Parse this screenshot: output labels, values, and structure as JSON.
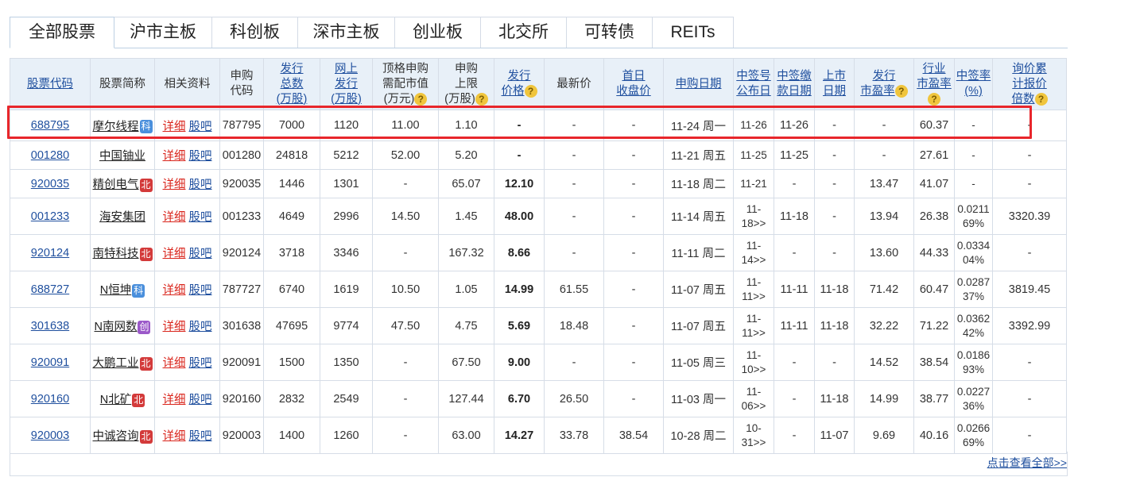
{
  "tabs": [
    {
      "label": "全部股票",
      "active": true,
      "width": 130
    },
    {
      "label": "沪市主板",
      "width": 122
    },
    {
      "label": "科创板",
      "width": 107
    },
    {
      "label": "深市主板",
      "width": 121
    },
    {
      "label": "创业板",
      "width": 107
    },
    {
      "label": "北交所",
      "width": 107
    },
    {
      "label": "可转债",
      "width": 107
    },
    {
      "label": "REITs",
      "width": 101
    }
  ],
  "headers": [
    {
      "lines": [
        "股票代码"
      ],
      "link": true
    },
    {
      "lines": [
        "股票简称"
      ]
    },
    {
      "lines": [
        "相关资料"
      ]
    },
    {
      "lines": [
        "申购",
        "代码"
      ]
    },
    {
      "lines": [
        "发行",
        "总数",
        "(万股)"
      ],
      "link": true
    },
    {
      "lines": [
        "网上",
        "发行",
        "(万股)"
      ],
      "link": true
    },
    {
      "lines": [
        "顶格申购",
        "需配市值",
        "(万元)"
      ],
      "q": true
    },
    {
      "lines": [
        "申购",
        "上限",
        "(万股)"
      ],
      "q": true
    },
    {
      "lines": [
        "发行",
        "价格"
      ],
      "link": true,
      "q": true
    },
    {
      "lines": [
        "最新价"
      ]
    },
    {
      "lines": [
        "首日",
        "收盘价"
      ],
      "link": true
    },
    {
      "lines": [
        "申购日期"
      ],
      "link": true
    },
    {
      "lines": [
        "中签号",
        "公布日"
      ],
      "link": true
    },
    {
      "lines": [
        "中签缴",
        "款日期"
      ],
      "link": true
    },
    {
      "lines": [
        "上市",
        "日期"
      ],
      "link": true
    },
    {
      "lines": [
        "发行",
        "市盈率"
      ],
      "link": true,
      "q": true
    },
    {
      "lines": [
        "行业",
        "市盈率"
      ],
      "link": true,
      "q": true
    },
    {
      "lines": [
        "中签率",
        "(%)"
      ],
      "link": true
    },
    {
      "lines": [
        "询价累",
        "计报价",
        "倍数"
      ],
      "link": true,
      "q": true
    }
  ],
  "links": {
    "detail": "详细",
    "bar": "股吧"
  },
  "rows": [
    {
      "code": "688795",
      "name": "摩尔线程",
      "badge": "科",
      "btype": "ke",
      "sub_code": "787795",
      "total": "7000",
      "online": "1120",
      "mktcap": "11.00",
      "limit": "1.10",
      "price": "-",
      "latest": "-",
      "first_close": "-",
      "sub_date": "11-24 周一",
      "lot_date": [
        "11-26"
      ],
      "pay_date": "11-26",
      "list_date": "-",
      "issue_pe": "-",
      "ind_pe": "60.37",
      "rate": [
        "-"
      ],
      "mult": "-",
      "cls": "hl"
    },
    {
      "code": "001280",
      "name": "中国铀业",
      "badge": "",
      "btype": "",
      "sub_code": "001280",
      "total": "24818",
      "online": "5212",
      "mktcap": "52.00",
      "limit": "5.20",
      "price": "-",
      "latest": "-",
      "first_close": "-",
      "sub_date": "11-21 周五",
      "lot_date": [
        "11-25"
      ],
      "pay_date": "11-25",
      "list_date": "-",
      "issue_pe": "-",
      "ind_pe": "27.61",
      "rate": [
        "-"
      ],
      "mult": "-",
      "cls": ""
    },
    {
      "code": "920035",
      "name": "精创电气",
      "badge": "北",
      "btype": "bei",
      "sub_code": "920035",
      "total": "1446",
      "online": "1301",
      "mktcap": "-",
      "limit": "65.07",
      "price": "12.10",
      "latest": "-",
      "first_close": "-",
      "sub_date": "11-18 周二",
      "lot_date": [
        "11-21"
      ],
      "pay_date": "-",
      "list_date": "-",
      "issue_pe": "13.47",
      "ind_pe": "41.07",
      "rate": [
        "-"
      ],
      "mult": "-",
      "cls": ""
    },
    {
      "code": "001233",
      "name": "海安集团",
      "badge": "",
      "btype": "",
      "sub_code": "001233",
      "total": "4649",
      "online": "2996",
      "mktcap": "14.50",
      "limit": "1.45",
      "price": "48.00",
      "latest": "-",
      "first_close": "-",
      "sub_date": "11-14 周五",
      "lot_date": [
        "11-",
        "18>>"
      ],
      "pay_date": "11-18",
      "list_date": "-",
      "issue_pe": "13.94",
      "ind_pe": "26.38",
      "rate": [
        "0.0211",
        "69%"
      ],
      "mult": "3320.39",
      "cls": "tall"
    },
    {
      "code": "920124",
      "name": "南特科技",
      "badge": "北",
      "btype": "bei",
      "sub_code": "920124",
      "total": "3718",
      "online": "3346",
      "mktcap": "-",
      "limit": "167.32",
      "price": "8.66",
      "latest": "-",
      "first_close": "-",
      "sub_date": "11-11 周二",
      "lot_date": [
        "11-",
        "14>>"
      ],
      "pay_date": "-",
      "list_date": "-",
      "issue_pe": "13.60",
      "ind_pe": "44.33",
      "rate": [
        "0.0334",
        "04%"
      ],
      "mult": "-",
      "cls": "tall"
    },
    {
      "code": "688727",
      "name": "N恒坤",
      "badge": "科",
      "btype": "ke",
      "sub_code": "787727",
      "total": "6740",
      "online": "1619",
      "mktcap": "10.50",
      "limit": "1.05",
      "price": "14.99",
      "latest": "61.55",
      "first_close": "-",
      "sub_date": "11-07 周五",
      "lot_date": [
        "11-",
        "11>>"
      ],
      "pay_date": "11-11",
      "list_date": "11-18",
      "issue_pe": "71.42",
      "ind_pe": "60.47",
      "rate": [
        "0.0287",
        "37%"
      ],
      "mult": "3819.45",
      "cls": "tall"
    },
    {
      "code": "301638",
      "name": "N南网数",
      "badge": "创",
      "btype": "chuang",
      "sub_code": "301638",
      "total": "47695",
      "online": "9774",
      "mktcap": "47.50",
      "limit": "4.75",
      "price": "5.69",
      "latest": "18.48",
      "first_close": "-",
      "sub_date": "11-07 周五",
      "lot_date": [
        "11-",
        "11>>"
      ],
      "pay_date": "11-11",
      "list_date": "11-18",
      "issue_pe": "32.22",
      "ind_pe": "71.22",
      "rate": [
        "0.0362",
        "42%"
      ],
      "mult": "3392.99",
      "cls": "tall"
    },
    {
      "code": "920091",
      "name": "大鹏工业",
      "badge": "北",
      "btype": "bei",
      "sub_code": "920091",
      "total": "1500",
      "online": "1350",
      "mktcap": "-",
      "limit": "67.50",
      "price": "9.00",
      "latest": "-",
      "first_close": "-",
      "sub_date": "11-05 周三",
      "lot_date": [
        "11-",
        "10>>"
      ],
      "pay_date": "-",
      "list_date": "-",
      "issue_pe": "14.52",
      "ind_pe": "38.54",
      "rate": [
        "0.0186",
        "93%"
      ],
      "mult": "-",
      "cls": "tall"
    },
    {
      "code": "920160",
      "name": "N北矿",
      "badge": "北",
      "btype": "bei",
      "sub_code": "920160",
      "total": "2832",
      "online": "2549",
      "mktcap": "-",
      "limit": "127.44",
      "price": "6.70",
      "latest": "26.50",
      "first_close": "-",
      "sub_date": "11-03 周一",
      "lot_date": [
        "11-",
        "06>>"
      ],
      "pay_date": "-",
      "list_date": "11-18",
      "issue_pe": "14.99",
      "ind_pe": "38.77",
      "rate": [
        "0.0227",
        "36%"
      ],
      "mult": "-",
      "cls": "tall"
    },
    {
      "code": "920003",
      "name": "中诚咨询",
      "badge": "北",
      "btype": "bei",
      "sub_code": "920003",
      "total": "1400",
      "online": "1260",
      "mktcap": "-",
      "limit": "63.00",
      "price": "14.27",
      "latest": "33.78",
      "first_close": "38.54",
      "sub_date": "10-28 周二",
      "lot_date": [
        "10-",
        "31>>"
      ],
      "pay_date": "-",
      "list_date": "11-07",
      "issue_pe": "9.69",
      "ind_pe": "40.16",
      "rate": [
        "0.0266",
        "69%"
      ],
      "mult": "-",
      "cls": "tall"
    }
  ],
  "more_link": "点击查看全部>>",
  "colors": {
    "header_bg": "#e8f0f8",
    "link": "#1f4f9e",
    "detail": "#d9241b",
    "highlight_border": "#e8262b"
  }
}
